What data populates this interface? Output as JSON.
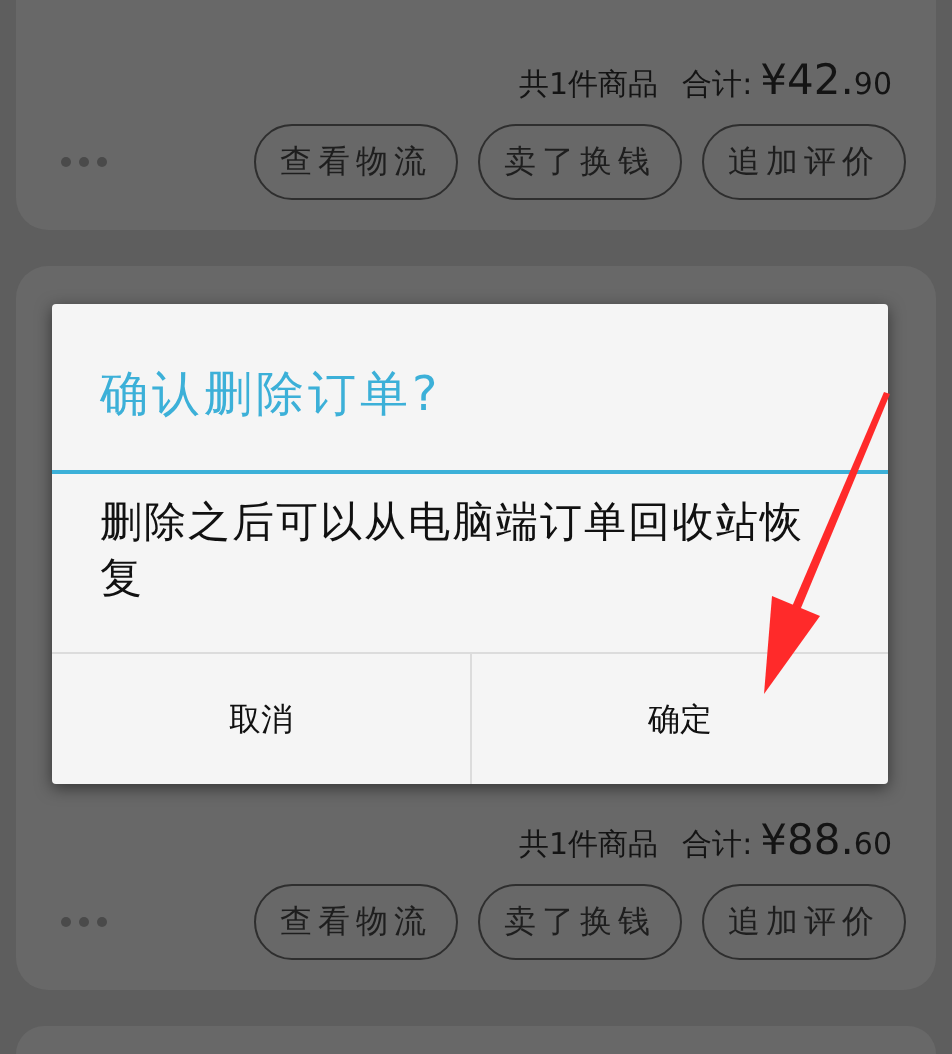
{
  "orders": [
    {
      "item_count": "共1件商品",
      "total_label": "合计:",
      "total": "¥42.90",
      "actions": [
        "查看物流",
        "卖了换钱",
        "追加评价"
      ]
    },
    {
      "item_count": "共1件商品",
      "total_label": "合计:",
      "total": "¥88.60",
      "actions": [
        "查看物流",
        "卖了换钱",
        "追加评价"
      ]
    }
  ],
  "dialog": {
    "title": "确认删除订单?",
    "message": "删除之后可以从电脑端订单回收站恢复",
    "buttons": [
      "取消",
      "确定"
    ]
  }
}
